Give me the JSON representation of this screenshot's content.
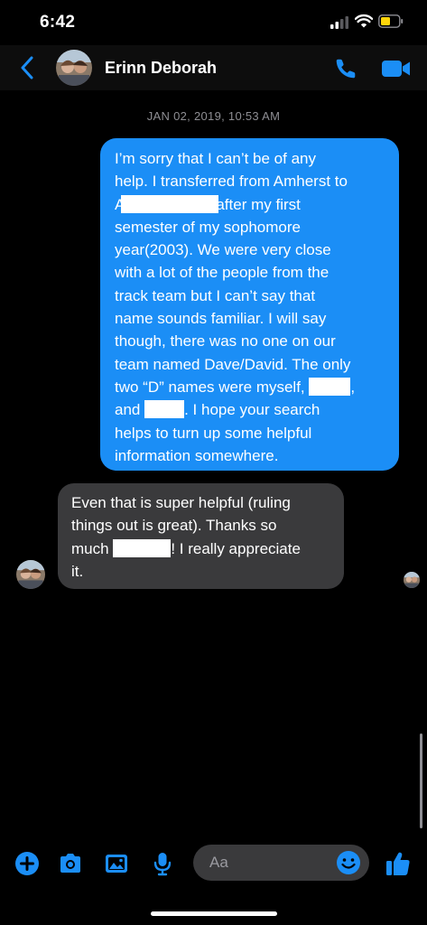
{
  "status_bar": {
    "time": "6:42"
  },
  "header": {
    "contact_name": "Erinn Deborah"
  },
  "conversation": {
    "timestamp": "JAN 02, 2019, 10:53 AM",
    "sent_message": {
      "lines": [
        "I’m sorry that I can’t be of any",
        "help. I transferred from Amherst to",
        "after my first",
        "semester of my sophomore",
        "year(2003). We were very close",
        "with a lot of the people from the",
        "track team but I can’t say that",
        "name sounds familiar. I will say",
        "though, there was no one on our",
        "team named Dave/David. The only",
        "two “D” names were myself,",
        ",",
        "and",
        ".  I hope your search",
        "helps to turn up some helpful",
        "information somewhere."
      ]
    },
    "received_message": {
      "lines": [
        "Even that is super helpful (ruling",
        "things out is great). Thanks so",
        "much",
        "! I really appreciate",
        "it."
      ]
    }
  },
  "composer": {
    "placeholder": "Aa"
  },
  "colors": {
    "accent": "#1b8ef6",
    "incoming_bubble": "#3a3a3c",
    "background": "#000000"
  }
}
